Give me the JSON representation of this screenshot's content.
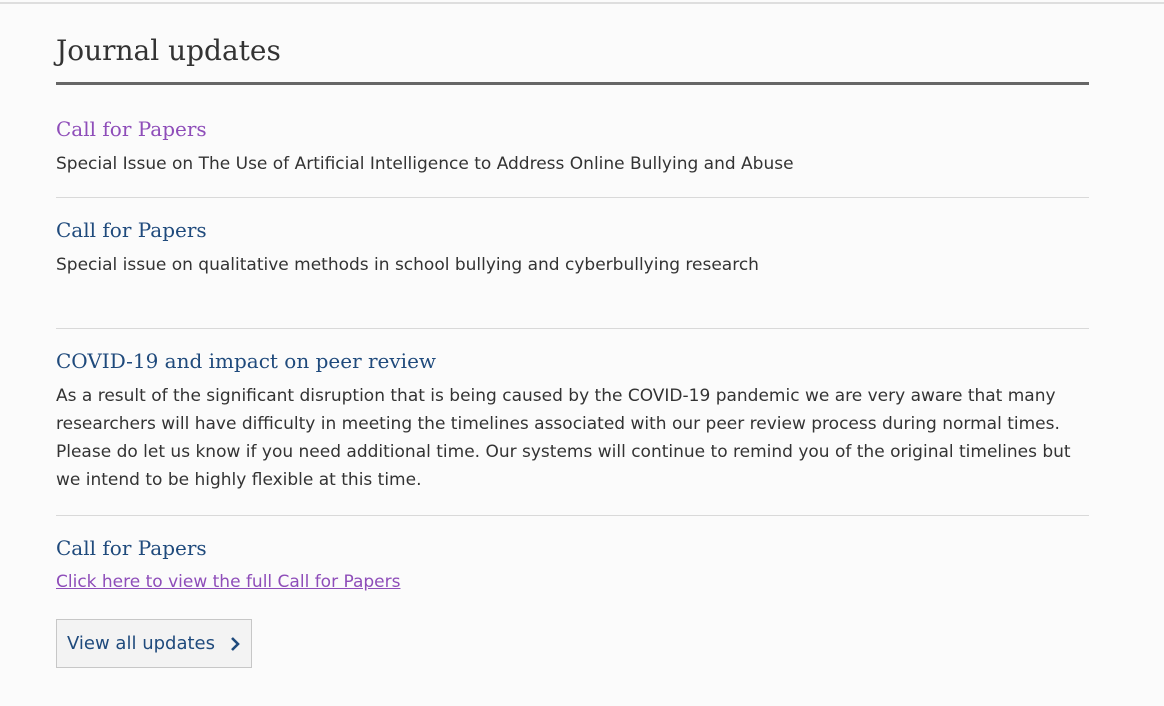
{
  "section": {
    "heading": "Journal updates"
  },
  "updates": [
    {
      "title": "Call for Papers",
      "text": "Special Issue on The Use of Artificial Intelligence to Address Online Bullying and Abuse"
    },
    {
      "title": "Call for Papers",
      "text": "Special issue on qualitative methods in school bullying and cyberbullying research"
    },
    {
      "title": "COVID-19 and impact on peer review",
      "text": "As a result of the significant disruption that is being caused by the COVID-19 pandemic we are very aware that many researchers will have difficulty in meeting the timelines associated with our peer review process during normal times. Please do let us know if you need additional time. Our systems will continue to remind you of the original timelines but we intend to be highly flexible at this time."
    },
    {
      "title": "Call for Papers",
      "link_text": "Click here to view the full Call for Papers"
    }
  ],
  "view_all": {
    "label": "View all updates",
    "icon": "chevron-right-icon"
  },
  "colors": {
    "link_blue": "#1f4a7c",
    "visited_purple": "#8e4db9",
    "text": "#333333",
    "rule": "#666666"
  }
}
